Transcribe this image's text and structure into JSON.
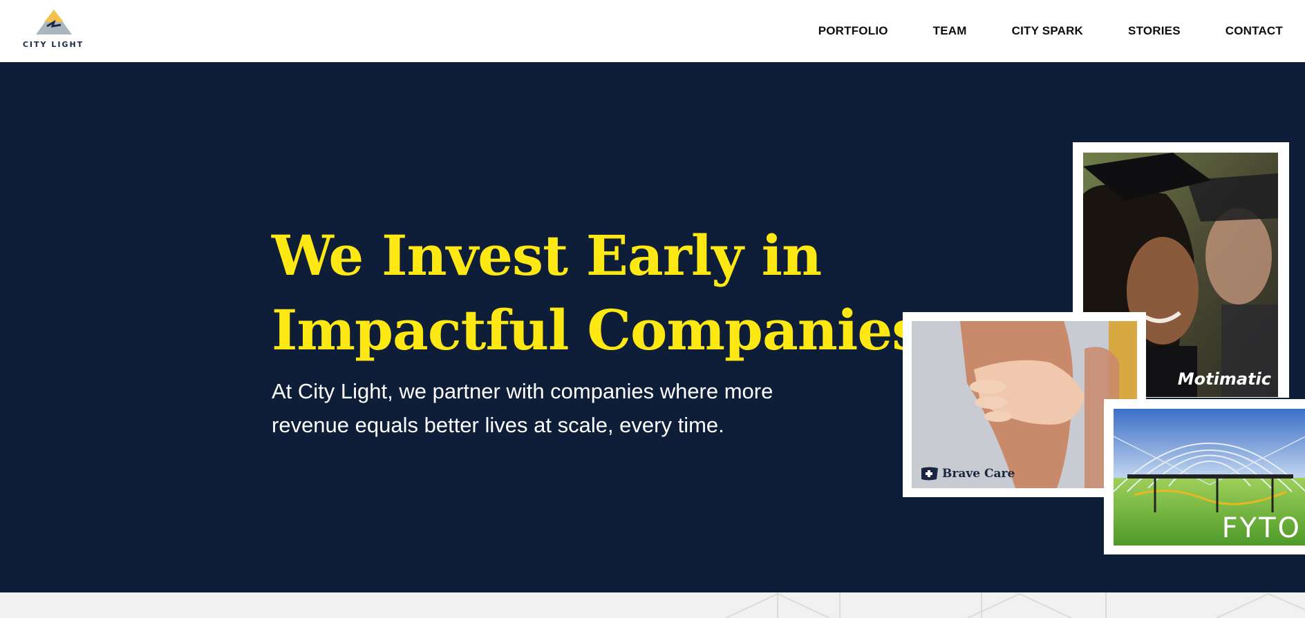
{
  "brand": {
    "name": "CITY LIGHT",
    "colors": {
      "accent_yellow": "#fde814",
      "navy": "#0e1e38",
      "logo_peak": "#f2c14e",
      "logo_base": "#a9b6bd"
    }
  },
  "nav": {
    "items": [
      {
        "label": "PORTFOLIO"
      },
      {
        "label": "TEAM"
      },
      {
        "label": "CITY SPARK"
      },
      {
        "label": "STORIES"
      },
      {
        "label": "CONTACT"
      }
    ]
  },
  "hero": {
    "headline_line1": "We Invest Early in",
    "headline_line2": "Impactful Companies",
    "subtext": "At City Light, we partner with companies where more revenue equals better lives at scale, every time."
  },
  "portfolio_cards": {
    "motimatic": {
      "label": "Motimatic"
    },
    "brave_care": {
      "label": "Brave Care"
    },
    "fyto": {
      "label": "FYTO"
    }
  }
}
